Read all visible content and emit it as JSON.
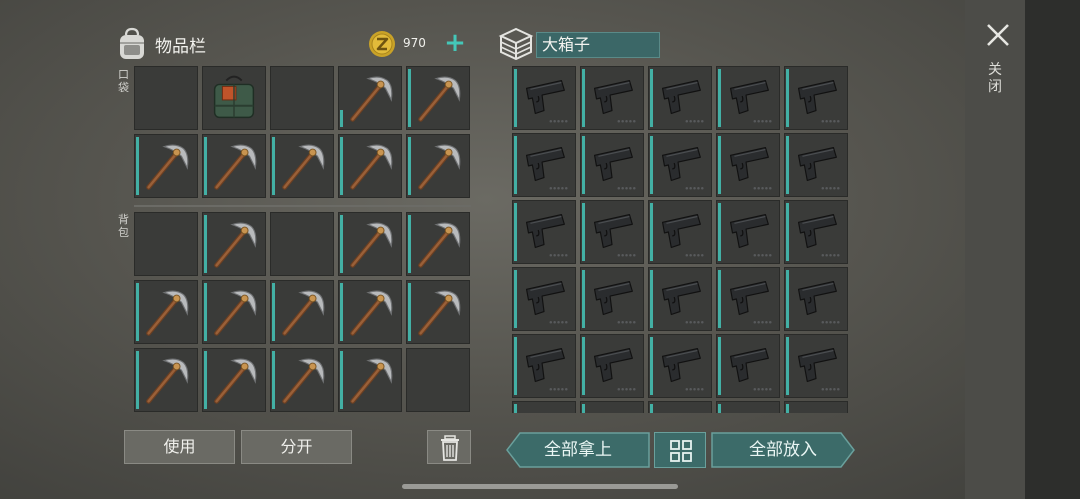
{
  "inventory": {
    "title": "物品栏",
    "coins": "970",
    "plus": "+",
    "pocket_label": "口袋",
    "backpack_label": "背包",
    "pocket_slots": [
      {
        "item": "empty",
        "bar": 0
      },
      {
        "item": "explosive",
        "bar": 0
      },
      {
        "item": "empty",
        "bar": 0
      },
      {
        "item": "pickaxe",
        "bar": 0.3
      },
      {
        "item": "pickaxe",
        "bar": 1
      },
      {
        "item": "pickaxe",
        "bar": 1
      },
      {
        "item": "pickaxe",
        "bar": 1
      },
      {
        "item": "pickaxe",
        "bar": 1
      },
      {
        "item": "pickaxe",
        "bar": 1
      },
      {
        "item": "pickaxe",
        "bar": 1
      }
    ],
    "backpack_slots": [
      {
        "item": "empty",
        "bar": 0
      },
      {
        "item": "pickaxe",
        "bar": 1
      },
      {
        "item": "empty",
        "bar": 0
      },
      {
        "item": "pickaxe",
        "bar": 1
      },
      {
        "item": "pickaxe",
        "bar": 1
      },
      {
        "item": "pickaxe",
        "bar": 1
      },
      {
        "item": "pickaxe",
        "bar": 1
      },
      {
        "item": "pickaxe",
        "bar": 1
      },
      {
        "item": "pickaxe",
        "bar": 1
      },
      {
        "item": "pickaxe",
        "bar": 1
      },
      {
        "item": "pickaxe",
        "bar": 1
      },
      {
        "item": "pickaxe",
        "bar": 1
      },
      {
        "item": "pickaxe",
        "bar": 1
      },
      {
        "item": "pickaxe",
        "bar": 1
      },
      {
        "item": "empty",
        "bar": 0
      }
    ]
  },
  "storage": {
    "name": "大箱子",
    "rows_visible": 6,
    "item": "pistol",
    "bar": 1
  },
  "actions": {
    "use_label": "使用",
    "split_label": "分开",
    "take_all_label": "全部拿上",
    "put_all_label": "全部放入"
  },
  "close_label": "关闭",
  "colors": {
    "accent_teal": "#43b0a5",
    "slot_bg": "#3a3b39",
    "button_teal": "#3c6b69"
  },
  "icons": [
    "backpack-icon",
    "coin-icon",
    "plus-icon",
    "storage-box-icon",
    "close-icon",
    "trash-icon",
    "grid-view-icon",
    "pickaxe-icon",
    "explosive-icon",
    "pistol-icon"
  ]
}
